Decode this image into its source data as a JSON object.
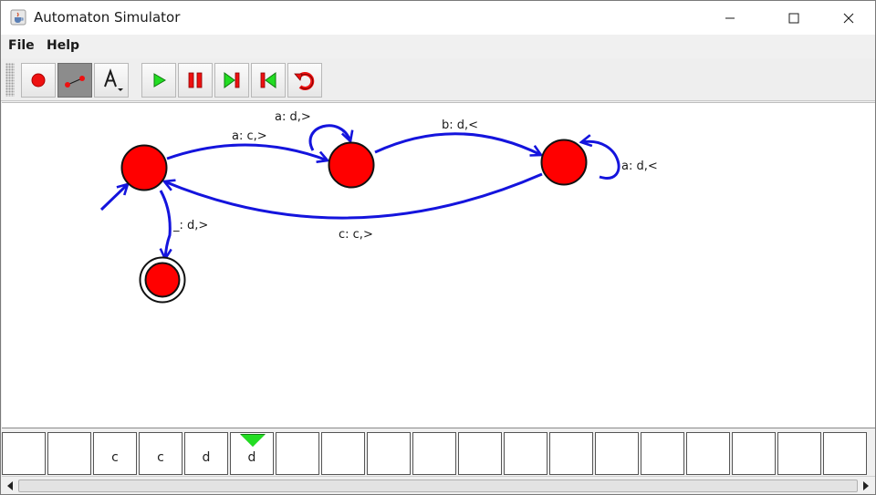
{
  "window": {
    "title": "Automaton Simulator",
    "controls": {
      "minimize_icon": "minimize-icon",
      "maximize_icon": "maximize-icon",
      "close_icon": "close-icon"
    }
  },
  "menu": {
    "items": [
      {
        "label": "File"
      },
      {
        "label": "Help"
      }
    ]
  },
  "toolbar": {
    "tools": [
      {
        "name": "add-state",
        "icon": "red-circle-icon"
      },
      {
        "name": "add-transition",
        "icon": "edge-icon",
        "pressed": true
      },
      {
        "name": "text",
        "icon": "text-A-icon"
      }
    ],
    "controls": [
      {
        "name": "run",
        "icon": "play-icon"
      },
      {
        "name": "pause",
        "icon": "pause-icon"
      },
      {
        "name": "step-forward",
        "icon": "step-forward-icon"
      },
      {
        "name": "step-back",
        "icon": "step-back-icon"
      },
      {
        "name": "reset",
        "icon": "reset-icon"
      }
    ]
  },
  "automaton": {
    "states": [
      {
        "id": "q0",
        "initial": true,
        "accepting": false
      },
      {
        "id": "q1",
        "initial": false,
        "accepting": false
      },
      {
        "id": "q2",
        "initial": false,
        "accepting": false
      },
      {
        "id": "q3",
        "initial": false,
        "accepting": true
      }
    ],
    "transitions": [
      {
        "from": "q0",
        "to": "q1",
        "label": "a: c,>"
      },
      {
        "from": "q1",
        "to": "q1",
        "label": "a: d,>"
      },
      {
        "from": "q1",
        "to": "q2",
        "label": "b: d,<"
      },
      {
        "from": "q2",
        "to": "q2",
        "label": "a: d,<"
      },
      {
        "from": "q2",
        "to": "q0",
        "label": "c: c,>"
      },
      {
        "from": "q0",
        "to": "q3",
        "label": "_: d,>"
      }
    ],
    "state_color": "#ff0000"
  },
  "tape": {
    "cells": [
      "",
      "",
      "c",
      "c",
      "d",
      "d",
      "",
      "",
      "",
      "",
      "",
      "",
      "",
      "",
      "",
      "",
      "",
      "",
      "",
      ""
    ],
    "head_index": 5,
    "head_color": "#22dd22"
  }
}
